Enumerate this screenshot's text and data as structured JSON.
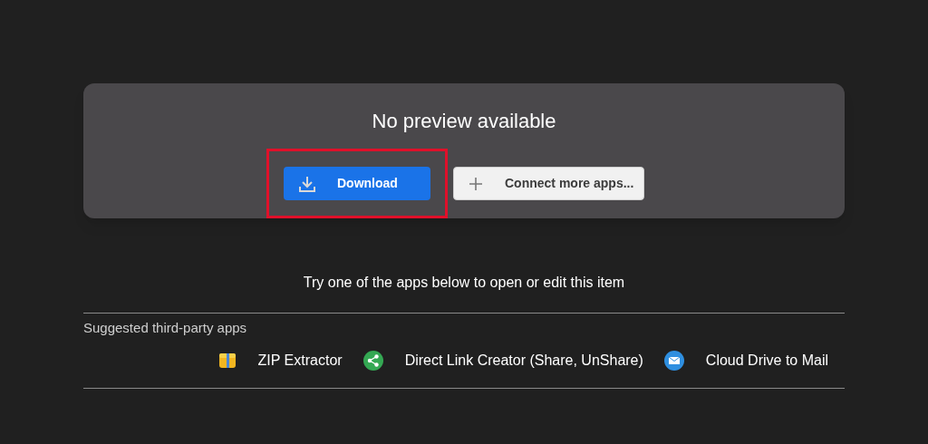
{
  "preview": {
    "title": "No preview available",
    "buttons": [
      {
        "kind": "download",
        "label": "Download",
        "highlighted": true
      },
      {
        "kind": "connect",
        "label": "Connect more apps..."
      }
    ]
  },
  "hint": "Try one of the apps below to open or edit this item",
  "suggested": {
    "heading": "Suggested third-party apps",
    "apps": [
      {
        "kind": "zip",
        "name": "ZIP Extractor"
      },
      {
        "kind": "share",
        "name": "Direct Link Creator (Share, UnShare)"
      },
      {
        "kind": "mail",
        "name": "Cloud Drive to Mail"
      }
    ]
  }
}
